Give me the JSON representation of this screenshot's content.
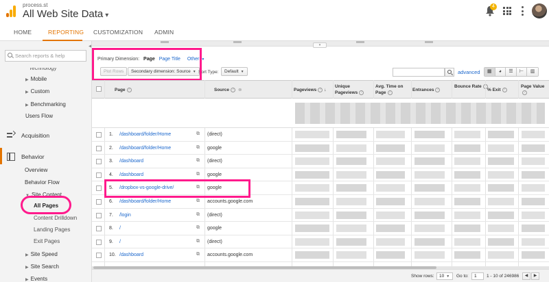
{
  "header": {
    "account": "process.st",
    "property": "All Web Site Data",
    "notification_count": "4"
  },
  "nav": {
    "tabs": [
      "HOME",
      "REPORTING",
      "CUSTOMIZATION",
      "ADMIN"
    ]
  },
  "sidebar": {
    "search_placeholder": "Search reports & help",
    "items": {
      "technology": "Technology",
      "mobile": "Mobile",
      "custom": "Custom",
      "benchmarking": "Benchmarking",
      "users_flow": "Users Flow",
      "acquisition": "Acquisition",
      "behavior": "Behavior",
      "overview": "Overview",
      "behavior_flow": "Behavior Flow",
      "site_content": "Site Content",
      "all_pages": "All Pages",
      "content_drilldown": "Content Drilldown",
      "landing_pages": "Landing Pages",
      "exit_pages": "Exit Pages",
      "site_speed": "Site Speed",
      "site_search": "Site Search",
      "events": "Events"
    }
  },
  "controls": {
    "primary_label": "Primary Dimension:",
    "primary_active": "Page",
    "primary_alt": "Page Title",
    "primary_other": "Other",
    "plot_rows": "Plot Rows",
    "secondary": "Secondary dimension: Source",
    "sort_label": "Sort Type:",
    "sort_value": "Default",
    "advanced": "advanced"
  },
  "table": {
    "columns": {
      "page": "Page",
      "source": "Source",
      "pageviews": "Pageviews",
      "unique_pageviews": "Unique Pageviews",
      "avg_time": "Avg. Time on Page",
      "entrances": "Entrances",
      "bounce_rate": "Bounce Rate",
      "exit": "% Exit",
      "page_value": "Page Value"
    },
    "rows": [
      {
        "num": "1.",
        "page": "/dashboard/folder/Home",
        "source": "(direct)"
      },
      {
        "num": "2.",
        "page": "/dashboard/folder/Home",
        "source": "google"
      },
      {
        "num": "3.",
        "page": "/dashboard",
        "source": "(direct)"
      },
      {
        "num": "4.",
        "page": "/dashboard",
        "source": "google"
      },
      {
        "num": "5.",
        "page": "/dropbox-vs-google-drive/",
        "source": "google"
      },
      {
        "num": "6.",
        "page": "/dashboard/folder/Home",
        "source": "accounts.google.com"
      },
      {
        "num": "7.",
        "page": "/login",
        "source": "(direct)"
      },
      {
        "num": "8.",
        "page": "/",
        "source": "google"
      },
      {
        "num": "9.",
        "page": "/",
        "source": "(direct)"
      },
      {
        "num": "10.",
        "page": "/dashboard",
        "source": "accounts.google.com"
      }
    ]
  },
  "footer": {
    "show_rows_label": "Show rows:",
    "show_rows_value": "10",
    "goto_label": "Go to:",
    "goto_value": "1",
    "range": "1 - 10 of 246986"
  },
  "colors": {
    "accent": "#e37400",
    "highlight": "#ff1a8c",
    "link": "#1a66cc"
  }
}
